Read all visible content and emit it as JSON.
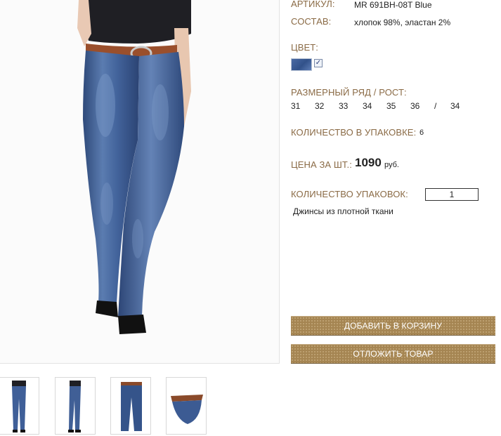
{
  "product": {
    "article_label": "АРТИКУЛ:",
    "article_value": "MR 691BH-08T Blue",
    "composition_label": "СОСТАВ:",
    "composition_value": "хлопок 98%, эластан 2%",
    "color_label": "ЦВЕТ:",
    "color_swatch": "#3f5f98",
    "color_checked_mark": "✓",
    "size_label": "РАЗМЕРНЫЙ РЯД / РОСТ:",
    "sizes": [
      "31",
      "32",
      "33",
      "34",
      "35",
      "36",
      "/",
      "34"
    ],
    "pack_qty_label": "КОЛИЧЕСТВО В УПАКОВКЕ:",
    "pack_qty_value": "6",
    "price_label": "ЦЕНА ЗА ШТ.:",
    "price_value": "1090",
    "price_unit": "руб.",
    "packs_label": "КОЛИЧЕСТВО УПАКОВОК:",
    "packs_value": "1",
    "description": "Джинсы из плотной ткани"
  },
  "actions": {
    "add_to_cart": "ДОБАВИТЬ В КОРЗИНУ",
    "save_item": "ОТЛОЖИТЬ ТОВАР"
  },
  "colors": {
    "label_brown": "#8a6a45",
    "button_brown": "#a58552",
    "denim": "#3f5f98"
  },
  "thumbnails": [
    {
      "icon": "jeans-front-view-thumbnail"
    },
    {
      "icon": "jeans-side-view-thumbnail"
    },
    {
      "icon": "jeans-flat-lay-thumbnail"
    },
    {
      "icon": "jeans-folded-thumbnail"
    }
  ]
}
